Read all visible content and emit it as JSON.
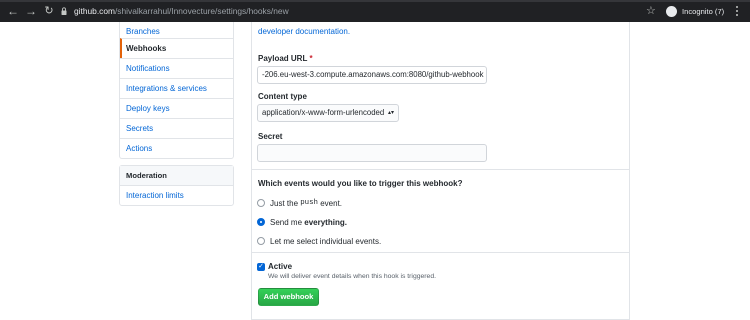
{
  "browser": {
    "url_host": "github.com",
    "url_path": "/shivalkarrahul/Innovecture/settings/hooks/new",
    "profile_label": "Incognito (7)"
  },
  "sidebar": {
    "items": [
      {
        "label": "Branches",
        "selected": false
      },
      {
        "label": "Webhooks",
        "selected": true
      },
      {
        "label": "Notifications",
        "selected": false
      },
      {
        "label": "Integrations & services",
        "selected": false
      },
      {
        "label": "Deploy keys",
        "selected": false
      },
      {
        "label": "Secrets",
        "selected": false
      },
      {
        "label": "Actions",
        "selected": false
      }
    ],
    "moderation": {
      "heading": "Moderation",
      "items": [
        {
          "label": "Interaction limits"
        }
      ]
    }
  },
  "form": {
    "doc_link": "developer documentation.",
    "payload_url_label": "Payload URL",
    "required_mark": "*",
    "payload_url_value": "-206.eu-west-3.compute.amazonaws.com:8080/github-webhook",
    "content_type_label": "Content type",
    "content_type_value": "application/x-www-form-urlencoded",
    "secret_label": "Secret",
    "secret_value": "",
    "events_question": "Which events would you like to trigger this webhook?",
    "events": {
      "push_prefix": "Just the",
      "push_code": "push",
      "push_suffix": "event.",
      "everything_prefix": "Send me",
      "everything_bold": "everything.",
      "individual": "Let me select individual events.",
      "selected": "everything"
    },
    "active_label": "Active",
    "active_checked": true,
    "active_note": "We will deliver event details when this hook is triggered.",
    "submit_label": "Add webhook"
  },
  "colors": {
    "link": "#0366d6",
    "selected_accent": "#e36209",
    "primary_button": "#28a745",
    "chrome_bg": "#202124"
  }
}
